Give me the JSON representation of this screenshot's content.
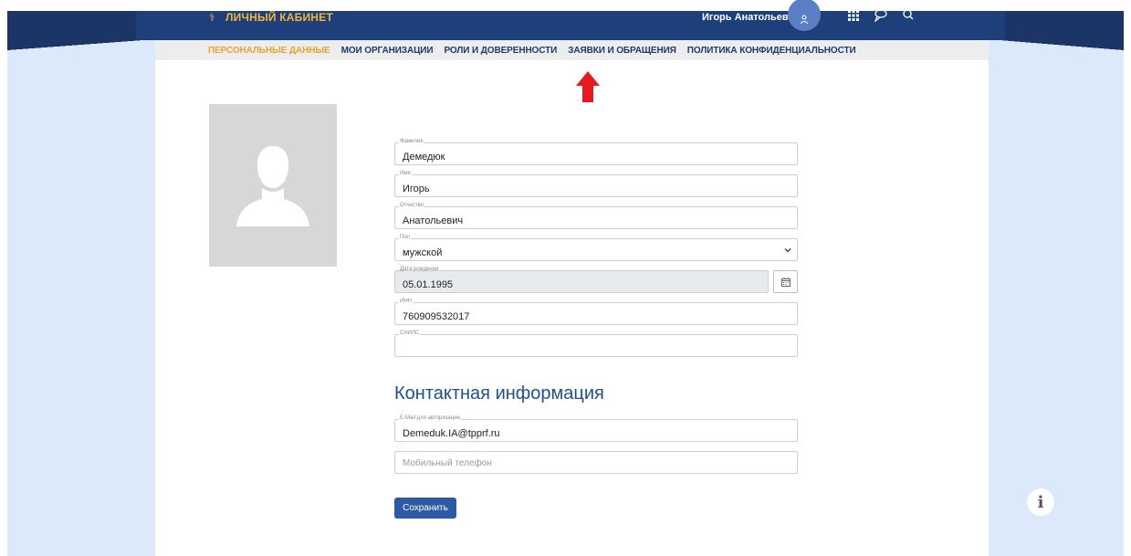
{
  "header": {
    "logo_text": "ЛИЧНЫЙ КАБИНЕТ",
    "user_name": "Игорь Анатольевич",
    "icons": [
      "user-icon",
      "apps-grid-icon",
      "chat-icon",
      "search-icon"
    ]
  },
  "nav": {
    "items": [
      {
        "label": "ПЕРСОНАЛЬНЫЕ ДАННЫЕ",
        "active": true
      },
      {
        "label": "МОИ ОРГАНИЗАЦИИ",
        "active": false
      },
      {
        "label": "РОЛИ И ДОВЕРЕННОСТИ",
        "active": false
      },
      {
        "label": "ЗАЯВКИ И ОБРАЩЕНИЯ",
        "active": false
      },
      {
        "label": "ПОЛИТИКА КОНФИДЕНЦИАЛЬНОСТИ",
        "active": false
      }
    ]
  },
  "form": {
    "surname": {
      "label": "Фамилия",
      "value": "Демедюк"
    },
    "name": {
      "label": "Имя",
      "value": "Игорь"
    },
    "patronymic": {
      "label": "Отчество",
      "value": "Анатольевич"
    },
    "gender": {
      "label": "Пол",
      "value": "мужской"
    },
    "birth_date": {
      "label": "Дата рождения",
      "value": "05.01.1995"
    },
    "inn": {
      "label": "ИНН",
      "value": "760909532017"
    },
    "snils": {
      "label": "СНИЛС",
      "value": ""
    }
  },
  "contact": {
    "title": "Контактная информация",
    "email": {
      "label": "E-Mail для авторизации",
      "value": "Demeduk.IA@tpprf.ru"
    },
    "phone": {
      "placeholder": "Мобильный телефон",
      "value": ""
    }
  },
  "actions": {
    "save_label": "Сохранить"
  },
  "colors": {
    "header_bg": "#1d3f7a",
    "nav_active": "#e8a431",
    "nav_text": "#1e3a6b",
    "accent_button": "#2e59a4",
    "section_title": "#1d4f91",
    "arrow": "#e8191e"
  }
}
